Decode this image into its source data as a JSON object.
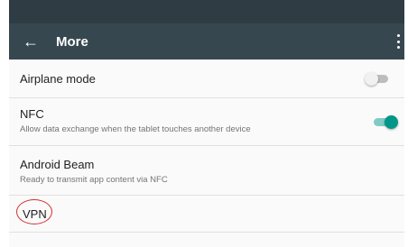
{
  "toolbar": {
    "title": "More",
    "back_icon": "arrow-left-icon",
    "menu_icon": "more-vert-icon",
    "color": "#37474f"
  },
  "settings": [
    {
      "title": "Airplane mode",
      "subtitle": "",
      "toggle": "off"
    },
    {
      "title": "NFC",
      "subtitle": "Allow data exchange when the tablet touches another device",
      "toggle": "on"
    },
    {
      "title": "Android Beam",
      "subtitle": "Ready to transmit app content via NFC"
    },
    {
      "title": "VPN",
      "subtitle": "",
      "highlighted": true
    }
  ],
  "colors": {
    "accent": "#009688",
    "highlight": "#d32f2f"
  }
}
